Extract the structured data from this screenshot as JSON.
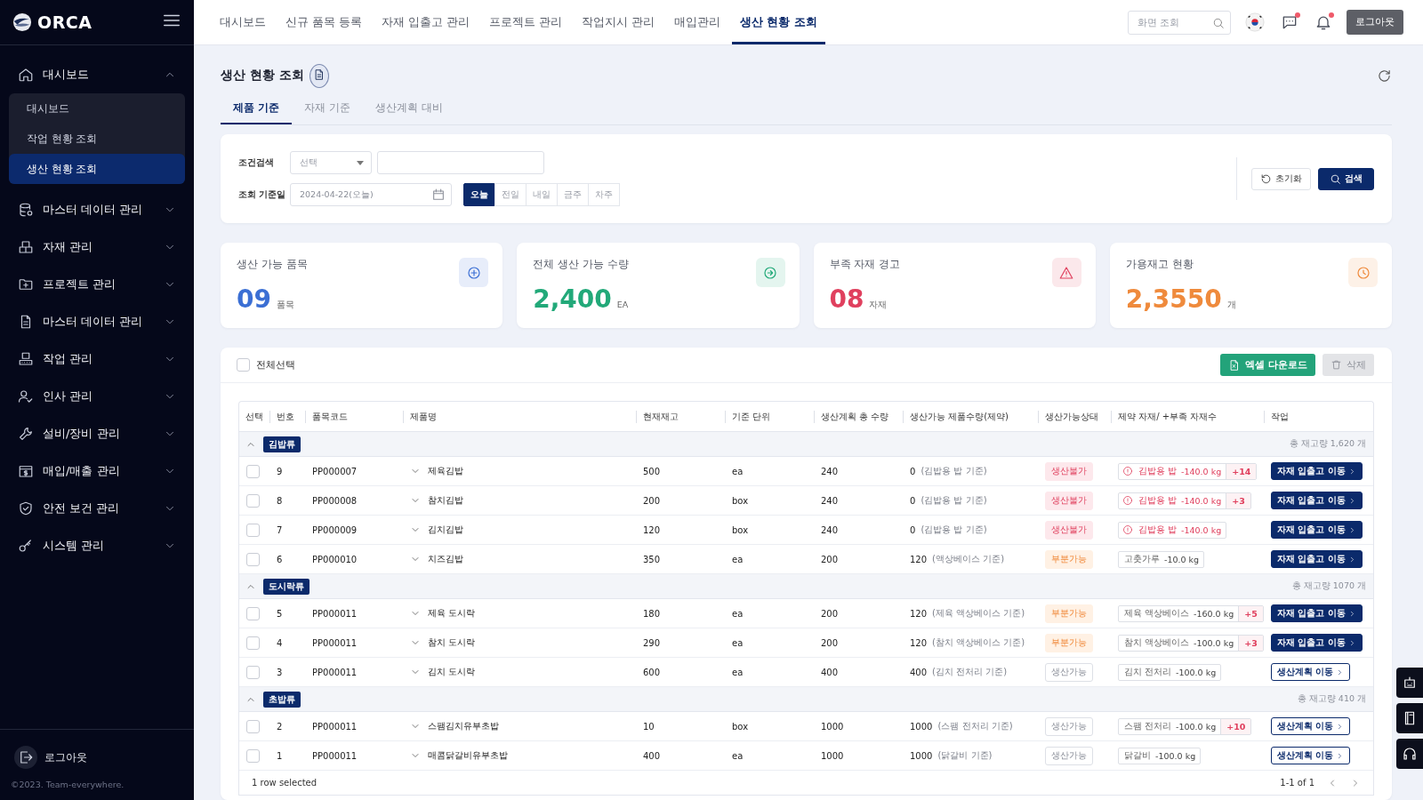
{
  "sidebar": {
    "logo": "ORCA",
    "items": [
      {
        "label": "대시보드",
        "expanded": true,
        "children": [
          {
            "label": "대시보드",
            "selected": false
          },
          {
            "label": "작업 현황 조회",
            "selected": false
          },
          {
            "label": "생산 현황 조회",
            "selected": true
          }
        ]
      },
      {
        "label": "마스터 데이터 관리",
        "expanded": false
      },
      {
        "label": "자재 관리",
        "expanded": false
      },
      {
        "label": "프로젝트 관리",
        "expanded": false
      },
      {
        "label": "마스터 데이터 관리",
        "expanded": false
      },
      {
        "label": "작업 관리",
        "expanded": false
      },
      {
        "label": "인사 관리",
        "expanded": false
      },
      {
        "label": "설비/장비 관리",
        "expanded": false
      },
      {
        "label": "매입/매출 관리",
        "expanded": false
      },
      {
        "label": "안전 보건 관리",
        "expanded": false
      },
      {
        "label": "시스템 관리",
        "expanded": false
      }
    ],
    "logout": "로그아웃",
    "copyright": "©2023. Team-everywhere."
  },
  "nav": {
    "tabs": [
      {
        "label": "대시보드",
        "selected": false
      },
      {
        "label": "신규 품목 등록",
        "selected": false
      },
      {
        "label": "자재 입출고 관리",
        "selected": false
      },
      {
        "label": "프로젝트 관리",
        "selected": false
      },
      {
        "label": "작업지시 관리",
        "selected": false
      },
      {
        "label": "매입관리",
        "selected": false
      },
      {
        "label": "생산 현황 조회",
        "selected": true
      }
    ],
    "search": {
      "placeholder": "화면 조회"
    },
    "chat": {
      "unread": true
    },
    "alerts": {
      "unread": true
    },
    "logout": "로그아웃"
  },
  "page": {
    "title": "생산 현황 조회",
    "tabs": [
      {
        "label": "제품 기준",
        "selected": true
      },
      {
        "label": "자재 기준",
        "selected": false
      },
      {
        "label": "생산계획 대비",
        "selected": false
      }
    ]
  },
  "filters": {
    "condition": {
      "label": "조건검색",
      "select": {
        "placeholder": "선택"
      }
    },
    "date": {
      "label": "조회 기준일",
      "value": "2024-04-22(오늘)"
    },
    "ranges": [
      {
        "label": "오늘",
        "selected": true
      },
      {
        "label": "전일",
        "selected": false
      },
      {
        "label": "내일",
        "selected": false
      },
      {
        "label": "금주",
        "selected": false
      },
      {
        "label": "차주",
        "selected": false
      }
    ],
    "reset": "초기화",
    "search": "검색"
  },
  "cards": [
    {
      "title": "생산 가능 품목",
      "value": "09",
      "unit": "품목",
      "color": "#3b6fd4"
    },
    {
      "title": "전체 생산 가능 수량",
      "value": "2,400",
      "unit": "EA",
      "color": "#22a979"
    },
    {
      "title": "부족 자재 경고",
      "value": "08",
      "unit": "자재",
      "color": "#e0405e"
    },
    {
      "title": "가용재고 현황",
      "value": "2,3550",
      "unit": "개",
      "color": "#ef8a3c"
    }
  ],
  "table": {
    "select_all": {
      "label": "전체선택",
      "checked": false
    },
    "excel": "엑셀 다운로드",
    "delete": {
      "label": "삭제",
      "disabled": true
    },
    "columns": [
      "선택",
      "번호",
      "품목코드",
      "제품명",
      "현재재고",
      "기준 단위",
      "생산계획 총 수량",
      "생산가능 제품수량(제약)",
      "생산가능상태",
      "제약 자재/ +부족 자재수",
      "작업"
    ],
    "groups": [
      {
        "name": "김밥류",
        "total": "총 재고량 1,620 개",
        "expanded": true,
        "rows": [
          {
            "checked": false,
            "no": "9",
            "code": "PP000007",
            "name": "제육김밥",
            "stock": "500",
            "unit": "ea",
            "plan": "240",
            "possible": "0",
            "basis": "(김밥용 밥 기준)",
            "status": {
              "label": "생산불가",
              "kind": "impossible"
            },
            "material": {
              "kind": "warning",
              "name": "김밥용 밥",
              "qty": "-140.0 kg",
              "extra": "+14"
            },
            "action": {
              "label": "자재 입출고 이동",
              "kind": "primary"
            }
          },
          {
            "checked": false,
            "no": "8",
            "code": "PP000008",
            "name": "참치김밥",
            "stock": "200",
            "unit": "box",
            "plan": "240",
            "possible": "0",
            "basis": "(김밥용 밥 기준)",
            "status": {
              "label": "생산불가",
              "kind": "impossible"
            },
            "material": {
              "kind": "warning",
              "name": "김밥용 밥",
              "qty": "-140.0 kg",
              "extra": "+3"
            },
            "action": {
              "label": "자재 입출고 이동",
              "kind": "primary"
            }
          },
          {
            "checked": false,
            "no": "7",
            "code": "PP000009",
            "name": "김치김밥",
            "stock": "120",
            "unit": "box",
            "plan": "240",
            "possible": "0",
            "basis": "(김밥용 밥 기준)",
            "status": {
              "label": "생산불가",
              "kind": "impossible"
            },
            "material": {
              "kind": "warning",
              "name": "김밥용 밥",
              "qty": "-140.0 kg"
            },
            "action": {
              "label": "자재 입출고 이동",
              "kind": "primary"
            }
          },
          {
            "checked": false,
            "no": "6",
            "code": "PP000010",
            "name": "치즈김밥",
            "stock": "350",
            "unit": "ea",
            "plan": "200",
            "possible": "120",
            "basis": "(액상베이스 기준)",
            "status": {
              "label": "부분가능",
              "kind": "partial"
            },
            "material": {
              "kind": "normal",
              "name": "고춧가루",
              "qty": "-10.0 kg"
            },
            "action": {
              "label": "자재 입출고 이동",
              "kind": "primary"
            }
          }
        ]
      },
      {
        "name": "도시락류",
        "total": "총 재고량 1070 개",
        "expanded": true,
        "rows": [
          {
            "checked": false,
            "no": "5",
            "code": "PP000011",
            "name": "제육 도시락",
            "stock": "180",
            "unit": "ea",
            "plan": "200",
            "possible": "120",
            "basis": "(제육 액상베이스 기준)",
            "status": {
              "label": "부분가능",
              "kind": "partial"
            },
            "material": {
              "kind": "normal",
              "name": "제육 액상베이스",
              "qty": "-160.0 kg",
              "extra": "+5"
            },
            "action": {
              "label": "자재 입출고 이동",
              "kind": "primary"
            }
          },
          {
            "checked": false,
            "no": "4",
            "code": "PP000011",
            "name": "참치 도시락",
            "stock": "290",
            "unit": "ea",
            "plan": "200",
            "possible": "120",
            "basis": "(참치 액상베이스 기준)",
            "status": {
              "label": "부분가능",
              "kind": "partial"
            },
            "material": {
              "kind": "normal",
              "name": "참치 액상베이스",
              "qty": "-100.0 kg",
              "extra": "+3"
            },
            "action": {
              "label": "자재 입출고 이동",
              "kind": "primary"
            }
          },
          {
            "checked": false,
            "no": "3",
            "code": "PP000011",
            "name": "김치 도시락",
            "stock": "600",
            "unit": "ea",
            "plan": "400",
            "possible": "400",
            "basis": "(김치 전처리 기준)",
            "status": {
              "label": "생산가능",
              "kind": "possible"
            },
            "material": {
              "kind": "normal",
              "name": "김치 전처리",
              "qty": "-100.0 kg"
            },
            "action": {
              "label": "생산계획 이동",
              "kind": "outline"
            }
          }
        ]
      },
      {
        "name": "초밥류",
        "total": "총 재고량 410 개",
        "expanded": true,
        "rows": [
          {
            "checked": false,
            "no": "2",
            "code": "PP000011",
            "name": "스팸김치유부초밥",
            "stock": "10",
            "unit": "box",
            "plan": "1000",
            "possible": "1000",
            "basis": "(스팸 전처리 기준)",
            "status": {
              "label": "생산가능",
              "kind": "possible"
            },
            "material": {
              "kind": "normal",
              "name": "스팸 전처리",
              "qty": "-100.0 kg",
              "extra": "+10"
            },
            "action": {
              "label": "생산계획 이동",
              "kind": "outline"
            }
          },
          {
            "checked": false,
            "no": "1",
            "code": "PP000011",
            "name": "매콤닭갈비유부초밥",
            "stock": "400",
            "unit": "ea",
            "plan": "1000",
            "possible": "1000",
            "basis": "(닭갈비 기준)",
            "status": {
              "label": "생산가능",
              "kind": "possible"
            },
            "material": {
              "kind": "normal",
              "name": "닭갈비",
              "qty": "-100.0 kg"
            },
            "action": {
              "label": "생산계획 이동",
              "kind": "outline"
            }
          }
        ]
      }
    ],
    "footer": {
      "selection": "1 row selected",
      "range": "1-1 of 1"
    }
  }
}
